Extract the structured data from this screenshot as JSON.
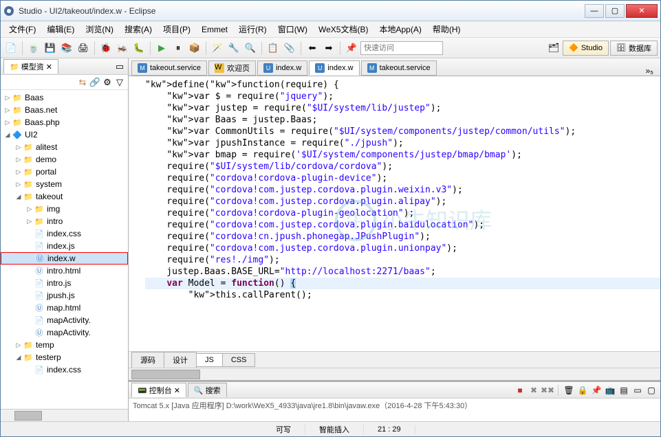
{
  "window": {
    "title": "Studio - UI2/takeout/index.w - Eclipse"
  },
  "menubar": [
    "文件(F)",
    "编辑(E)",
    "浏览(N)",
    "搜索(A)",
    "项目(P)",
    "Emmet",
    "运行(R)",
    "窗口(W)",
    "WeX5文档(B)",
    "本地App(A)",
    "帮助(H)"
  ],
  "toolbar": {
    "quick_access_placeholder": "快速访问"
  },
  "perspectives": {
    "studio": "Studio",
    "database": "数据库"
  },
  "sidebar": {
    "view_title": "模型资",
    "tree": [
      {
        "label": "Baas",
        "depth": 0,
        "type": "folder",
        "expand": "▷"
      },
      {
        "label": "Baas.net",
        "depth": 0,
        "type": "folder",
        "expand": "▷"
      },
      {
        "label": "Baas.php",
        "depth": 0,
        "type": "folder",
        "expand": "▷"
      },
      {
        "label": "UI2",
        "depth": 0,
        "type": "ui",
        "expand": "◢"
      },
      {
        "label": "alitest",
        "depth": 1,
        "type": "folder",
        "expand": "▷"
      },
      {
        "label": "demo",
        "depth": 1,
        "type": "folder",
        "expand": "▷"
      },
      {
        "label": "portal",
        "depth": 1,
        "type": "folder",
        "expand": "▷"
      },
      {
        "label": "system",
        "depth": 1,
        "type": "folder",
        "expand": "▷"
      },
      {
        "label": "takeout",
        "depth": 1,
        "type": "folder",
        "expand": "◢"
      },
      {
        "label": "img",
        "depth": 2,
        "type": "folder",
        "expand": "▷"
      },
      {
        "label": "intro",
        "depth": 2,
        "type": "folder",
        "expand": "▷"
      },
      {
        "label": "index.css",
        "depth": 2,
        "type": "file",
        "expand": ""
      },
      {
        "label": "index.js",
        "depth": 2,
        "type": "file",
        "expand": ""
      },
      {
        "label": "index.w",
        "depth": 2,
        "type": "ufile",
        "expand": "",
        "selected": true
      },
      {
        "label": "intro.html",
        "depth": 2,
        "type": "ufile",
        "expand": ""
      },
      {
        "label": "intro.js",
        "depth": 2,
        "type": "file",
        "expand": ""
      },
      {
        "label": "jpush.js",
        "depth": 2,
        "type": "file",
        "expand": ""
      },
      {
        "label": "map.html",
        "depth": 2,
        "type": "ufile",
        "expand": ""
      },
      {
        "label": "mapActivity.",
        "depth": 2,
        "type": "file",
        "expand": ""
      },
      {
        "label": "mapActivity.",
        "depth": 2,
        "type": "ufile",
        "expand": ""
      },
      {
        "label": "temp",
        "depth": 1,
        "type": "folder",
        "expand": "▷"
      },
      {
        "label": "testerp",
        "depth": 1,
        "type": "folder",
        "expand": "◢"
      },
      {
        "label": "index.css",
        "depth": 2,
        "type": "file",
        "expand": ""
      }
    ]
  },
  "editor_tabs": [
    {
      "label": "takeout.service",
      "icon": "M",
      "active": false
    },
    {
      "label": "欢迎页",
      "icon": "W",
      "active": false
    },
    {
      "label": "index.w",
      "icon": "U",
      "active": false
    },
    {
      "label": "index.w",
      "icon": "U",
      "active": true
    },
    {
      "label": "takeout.service",
      "icon": "M",
      "active": false
    }
  ],
  "code": {
    "l1": "define(function(require) {",
    "l2": "    var $ = require(\"jquery\");",
    "l3": "    var justep = require(\"$UI/system/lib/justep\");",
    "l4": "    var Baas = justep.Baas;",
    "l5": "    var CommonUtils = require(\"$UI/system/components/justep/common/utils\");",
    "l6": "    var jpushInstance = require(\"./jpush\");",
    "l7": "    var bmap = require('$UI/system/components/justep/bmap/bmap');",
    "l8": "",
    "l9": "    require(\"$UI/system/lib/cordova/cordova\");",
    "l10": "    require(\"cordova!cordova-plugin-device\");",
    "l11": "    require(\"cordova!com.justep.cordova.plugin.weixin.v3\");",
    "l12": "    require(\"cordova!com.justep.cordova.plugin.alipay\");",
    "l13": "    require(\"cordova!cordova-plugin-geolocation\");",
    "l14": "    require(\"cordova!com.justep.cordova.plugin.baidulocation\");",
    "l15": "    require(\"cordova!cn.jpush.phonegap.JPushPlugin\");",
    "l16": "    require(\"cordova!com.justep.cordova.plugin.unionpay\");",
    "l17": "    require(\"res!./img\");",
    "l18": "",
    "l19": "    justep.Baas.BASE_URL=\"http://localhost:2271/baas\";",
    "l20": "",
    "l21": "    var Model = function() {",
    "l22": "        this.callParent();",
    "sel": "{"
  },
  "bottom_tabs": [
    "源码",
    "设计",
    "JS",
    "CSS"
  ],
  "bottom_active": "JS",
  "console": {
    "tab1": "控制台",
    "tab2": "搜索",
    "text": "Tomcat 5.x [Java 应用程序] D:\\work\\WeX5_4933\\java\\jre1.8\\bin\\javaw.exe（2016-4-28 下午5:43:30）"
  },
  "statusbar": {
    "mode": "可写",
    "insert": "智能插入",
    "pos": "21 : 29"
  },
  "watermark": "小牛知识库"
}
